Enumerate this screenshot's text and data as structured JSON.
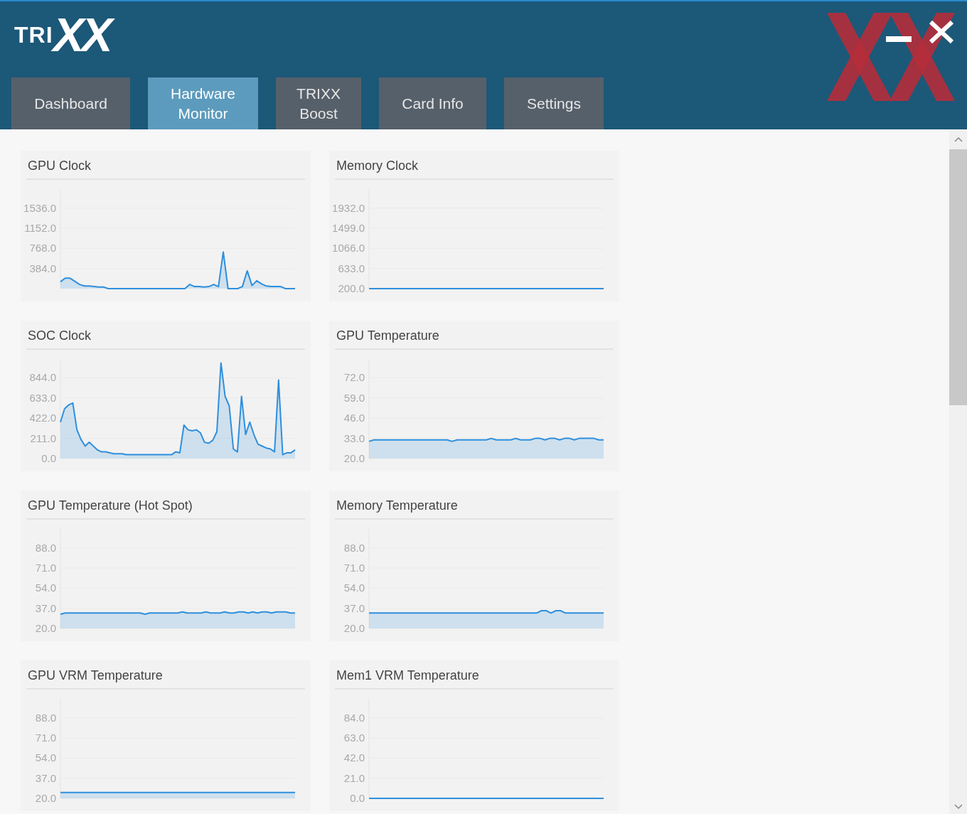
{
  "logo": {
    "small": "TRI",
    "large": "XX"
  },
  "tabs": [
    {
      "label": "Dashboard",
      "selected": false
    },
    {
      "label": "Hardware Monitor",
      "selected": true
    },
    {
      "label": "TRIXX Boost",
      "selected": false
    },
    {
      "label": "Card Info",
      "selected": false
    },
    {
      "label": "Settings",
      "selected": false
    }
  ],
  "panels": [
    {
      "title": "GPU Clock",
      "chart_data": {
        "type": "area",
        "ylim": [
          0,
          1900
        ],
        "grid": true,
        "yticks": [
          {
            "value": 384,
            "label": "384.0"
          },
          {
            "value": 768,
            "label": "768.0"
          },
          {
            "value": 1152,
            "label": "1152.0"
          },
          {
            "value": 1536,
            "label": "1536.0"
          }
        ],
        "series": [
          {
            "color": "#2f8fdc",
            "values": [
              130,
              200,
              200,
              140,
              80,
              50,
              50,
              40,
              30,
              30,
              0,
              0,
              0,
              0,
              0,
              0,
              0,
              0,
              0,
              0,
              0,
              0,
              0,
              0,
              0,
              0,
              0,
              80,
              40,
              40,
              30,
              40,
              80,
              40,
              700,
              0,
              0,
              0,
              40,
              340,
              60,
              150,
              90,
              50,
              40,
              40,
              40,
              0,
              0,
              0
            ]
          }
        ]
      }
    },
    {
      "title": "Memory Clock",
      "chart_data": {
        "type": "line",
        "ylim": [
          200,
          2340
        ],
        "grid": true,
        "yticks": [
          {
            "value": 200,
            "label": "200.0"
          },
          {
            "value": 633,
            "label": "633.0"
          },
          {
            "value": 1066,
            "label": "1066.0"
          },
          {
            "value": 1499,
            "label": "1499.0"
          },
          {
            "value": 1932,
            "label": "1932.0"
          }
        ],
        "series": [
          {
            "color": "#2f8fdc",
            "values": [
              200,
              200,
              200,
              200,
              200,
              200,
              200,
              200,
              200,
              200,
              200,
              200,
              200,
              200,
              200,
              200,
              200,
              200,
              200,
              200,
              200,
              200,
              200,
              200,
              200,
              200,
              200,
              200,
              200,
              200,
              200,
              200,
              200,
              200,
              200,
              200,
              200,
              200,
              200,
              200,
              200,
              200,
              200,
              200,
              200,
              200
            ]
          }
        ]
      }
    },
    {
      "title": "SOC Clock",
      "chart_data": {
        "type": "area",
        "ylim": [
          0,
          1040
        ],
        "grid": true,
        "yticks": [
          {
            "value": 0,
            "label": "0.0"
          },
          {
            "value": 211,
            "label": "211.0"
          },
          {
            "value": 422,
            "label": "422.0"
          },
          {
            "value": 633,
            "label": "633.0"
          },
          {
            "value": 844,
            "label": "844.0"
          }
        ],
        "series": [
          {
            "color": "#2f8fdc",
            "values": [
              380,
              520,
              560,
              580,
              300,
              200,
              130,
              170,
              130,
              90,
              70,
              70,
              60,
              50,
              50,
              50,
              40,
              40,
              40,
              40,
              40,
              40,
              40,
              40,
              40,
              40,
              40,
              40,
              70,
              60,
              350,
              300,
              290,
              300,
              270,
              170,
              160,
              190,
              280,
              1000,
              650,
              550,
              100,
              70,
              650,
              250,
              380,
              250,
              150,
              130,
              110,
              100,
              70,
              820,
              40,
              60,
              60,
              90
            ]
          }
        ]
      }
    },
    {
      "title": "GPU Temperature",
      "chart_data": {
        "type": "area",
        "ylim": [
          20,
          84
        ],
        "grid": true,
        "yticks": [
          {
            "value": 20,
            "label": "20.0"
          },
          {
            "value": 33,
            "label": "33.0"
          },
          {
            "value": 46,
            "label": "46.0"
          },
          {
            "value": 59,
            "label": "59.0"
          },
          {
            "value": 72,
            "label": "72.0"
          }
        ],
        "series": [
          {
            "color": "#2f8fdc",
            "values": [
              31,
              32,
              32,
              32,
              32,
              32,
              32,
              32,
              32,
              32,
              32,
              32,
              32,
              32,
              32,
              32,
              32,
              31,
              32,
              32,
              32,
              32,
              32,
              32,
              32,
              33,
              32,
              32,
              32,
              32,
              33,
              32,
              32,
              32,
              33,
              33,
              32,
              33,
              33,
              32,
              33,
              33,
              32,
              33,
              33,
              33,
              33,
              32,
              32
            ]
          }
        ]
      }
    },
    {
      "title": "GPU Temperature (Hot Spot)",
      "chart_data": {
        "type": "area",
        "ylim": [
          20,
          104
        ],
        "grid": true,
        "yticks": [
          {
            "value": 20,
            "label": "20.0"
          },
          {
            "value": 37,
            "label": "37.0"
          },
          {
            "value": 54,
            "label": "54.0"
          },
          {
            "value": 71,
            "label": "71.0"
          },
          {
            "value": 88,
            "label": "88.0"
          }
        ],
        "series": [
          {
            "color": "#2f8fdc",
            "values": [
              32,
              33,
              33,
              33,
              33,
              33,
              33,
              33,
              33,
              33,
              33,
              33,
              33,
              33,
              33,
              33,
              33,
              33,
              32,
              33,
              33,
              33,
              33,
              33,
              33,
              33,
              34,
              33,
              33,
              33,
              33,
              34,
              33,
              33,
              33,
              34,
              33,
              33,
              34,
              34,
              33,
              34,
              33,
              34,
              34,
              33,
              34,
              34,
              34,
              33,
              33
            ]
          }
        ]
      }
    },
    {
      "title": "Memory Temperature",
      "chart_data": {
        "type": "area",
        "ylim": [
          20,
          104
        ],
        "grid": true,
        "yticks": [
          {
            "value": 20,
            "label": "20.0"
          },
          {
            "value": 37,
            "label": "37.0"
          },
          {
            "value": 54,
            "label": "54.0"
          },
          {
            "value": 71,
            "label": "71.0"
          },
          {
            "value": 88,
            "label": "88.0"
          }
        ],
        "series": [
          {
            "color": "#2f8fdc",
            "values": [
              33,
              33,
              33,
              33,
              33,
              33,
              33,
              33,
              33,
              33,
              33,
              33,
              33,
              33,
              33,
              33,
              33,
              33,
              33,
              33,
              33,
              33,
              33,
              33,
              33,
              33,
              33,
              33,
              33,
              33,
              33,
              33,
              33,
              33,
              33,
              33,
              35,
              35,
              33,
              35,
              35,
              33,
              33,
              33,
              33,
              33,
              33,
              33,
              33,
              33
            ]
          }
        ]
      }
    },
    {
      "title": "GPU VRM Temperature",
      "chart_data": {
        "type": "area",
        "ylim": [
          20,
          104
        ],
        "grid": true,
        "yticks": [
          {
            "value": 20,
            "label": "20.0"
          },
          {
            "value": 37,
            "label": "37.0"
          },
          {
            "value": 54,
            "label": "54.0"
          },
          {
            "value": 71,
            "label": "71.0"
          },
          {
            "value": 88,
            "label": "88.0"
          }
        ],
        "series": [
          {
            "color": "#2f8fdc",
            "values": [
              25,
              25,
              25,
              25,
              25,
              25,
              25,
              25,
              25,
              25,
              25,
              25,
              25,
              25,
              25,
              25,
              25,
              25,
              25,
              25,
              25,
              25,
              25,
              25,
              25,
              25,
              25,
              25,
              25,
              25
            ]
          }
        ]
      }
    },
    {
      "title": "Mem1 VRM Temperature",
      "chart_data": {
        "type": "line",
        "ylim": [
          0,
          104
        ],
        "grid": true,
        "yticks": [
          {
            "value": 0,
            "label": "0.0"
          },
          {
            "value": 21,
            "label": "21.0"
          },
          {
            "value": 42,
            "label": "42.0"
          },
          {
            "value": 63,
            "label": "63.0"
          },
          {
            "value": 84,
            "label": "84.0"
          }
        ],
        "series": [
          {
            "color": "#2f8fdc",
            "values": [
              0,
              0,
              0,
              0,
              0,
              0,
              0,
              0,
              0,
              0,
              0,
              0,
              0,
              0,
              0,
              0,
              0,
              0,
              0,
              0,
              0,
              0,
              0,
              0,
              0,
              0,
              0,
              0,
              0,
              0
            ]
          }
        ]
      }
    }
  ]
}
